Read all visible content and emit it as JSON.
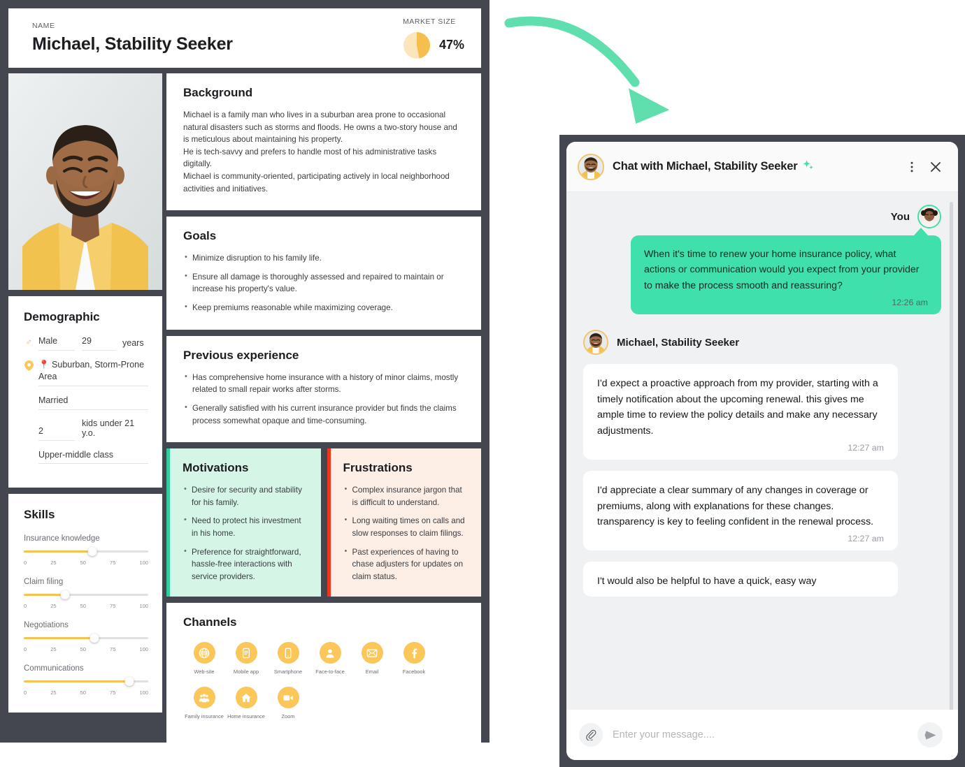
{
  "header": {
    "name_label": "NAME",
    "name": "Michael, Stability Seeker",
    "market_label": "MARKET SIZE",
    "market_pct": "47%",
    "market_value": 47,
    "donut_color": "#f6bf4d",
    "donut_track": "#fbe6bc"
  },
  "demographic": {
    "title": "Demographic",
    "gender": "Male",
    "age": "29",
    "age_unit": "years",
    "location": "📍 Suburban, Storm-Prone Area",
    "marital": "Married",
    "kids_count": "2",
    "kids_label": "kids under 21 y.o.",
    "class": "Upper-middle class"
  },
  "skills": {
    "title": "Skills",
    "ticks": [
      "0",
      "25",
      "50",
      "75",
      "100"
    ],
    "items": [
      {
        "label": "Insurance knowledge",
        "value": 55
      },
      {
        "label": "Claim filing",
        "value": 33
      },
      {
        "label": "Negotiations",
        "value": 57
      },
      {
        "label": "Communications",
        "value": 85
      }
    ]
  },
  "background": {
    "title": "Background",
    "paragraphs": [
      "Michael is a family man who lives in a suburban area prone to occasional natural disasters such as storms and floods. He owns a two-story house and is meticulous about maintaining his property.",
      "He is tech-savvy and prefers to handle most of his administrative tasks digitally.",
      "Michael is community-oriented, participating actively in local neighborhood activities and initiatives."
    ]
  },
  "goals": {
    "title": "Goals",
    "items": [
      "Minimize disruption to his family life.",
      "Ensure all damage is thoroughly assessed and repaired to maintain or increase his property's value.",
      "Keep premiums reasonable while maximizing coverage."
    ]
  },
  "previous_experience": {
    "title": "Previous experience",
    "items": [
      "Has comprehensive home insurance with a history of minor claims, mostly related to small repair works after storms.",
      "Generally satisfied with his current insurance provider but finds the claims process somewhat opaque and time-consuming."
    ]
  },
  "motivations": {
    "title": "Motivations",
    "accent": "#2ecf9b",
    "items": [
      "Desire for security and stability for his family.",
      "Need to protect his investment in his home.",
      "Preference for straightforward, hassle-free interactions with service providers."
    ]
  },
  "frustrations": {
    "title": "Frustrations",
    "accent": "#f1351b",
    "items": [
      "Complex insurance jargon that is difficult to understand.",
      "Long waiting times on calls and slow responses to claim filings.",
      "Past experiences of having to chase adjusters for updates on claim status."
    ]
  },
  "channels": {
    "title": "Channels",
    "items": [
      {
        "label": "Web-site",
        "icon": "globe-icon"
      },
      {
        "label": "Mobile app",
        "icon": "mobile-app-icon"
      },
      {
        "label": "Smartphone",
        "icon": "smartphone-icon"
      },
      {
        "label": "Face-to-face",
        "icon": "person-icon"
      },
      {
        "label": "Email",
        "icon": "email-icon"
      },
      {
        "label": "Facebook",
        "icon": "facebook-icon"
      },
      {
        "label": "Family insurance",
        "icon": "family-icon"
      },
      {
        "label": "Home insurance",
        "icon": "home-icon"
      },
      {
        "label": "Zoom",
        "icon": "video-camera-icon"
      }
    ]
  },
  "chat": {
    "title": "Chat with Michael, Stability Seeker",
    "sparkle": "✦",
    "you_label": "You",
    "persona_label": "Michael, Stability Seeker",
    "messages": [
      {
        "from": "you",
        "text": "When it's time to renew your home insurance policy, what actions or communication would you expect from your provider to make the process smooth and reassuring?",
        "time": "12:26 am"
      },
      {
        "from": "them",
        "text": "I'd expect a proactive approach from my provider, starting with a timely notification about the upcoming renewal. this gives me ample time to review the policy details and make any necessary adjustments.",
        "time": "12:27 am"
      },
      {
        "from": "them",
        "text": "I'd appreciate a clear summary of any changes in coverage or premiums, along with explanations for these changes. transparency is key to feeling confident in the renewal process.",
        "time": "12:27 am"
      },
      {
        "from": "them",
        "text": "I't would also be helpful to have a quick, easy way",
        "time": ""
      }
    ],
    "input_placeholder": "Enter your message....",
    "input_value": ""
  },
  "colors": {
    "frame": "#44474f",
    "accent_green": "#3fe0ab",
    "accent_yellow": "#fac758"
  }
}
